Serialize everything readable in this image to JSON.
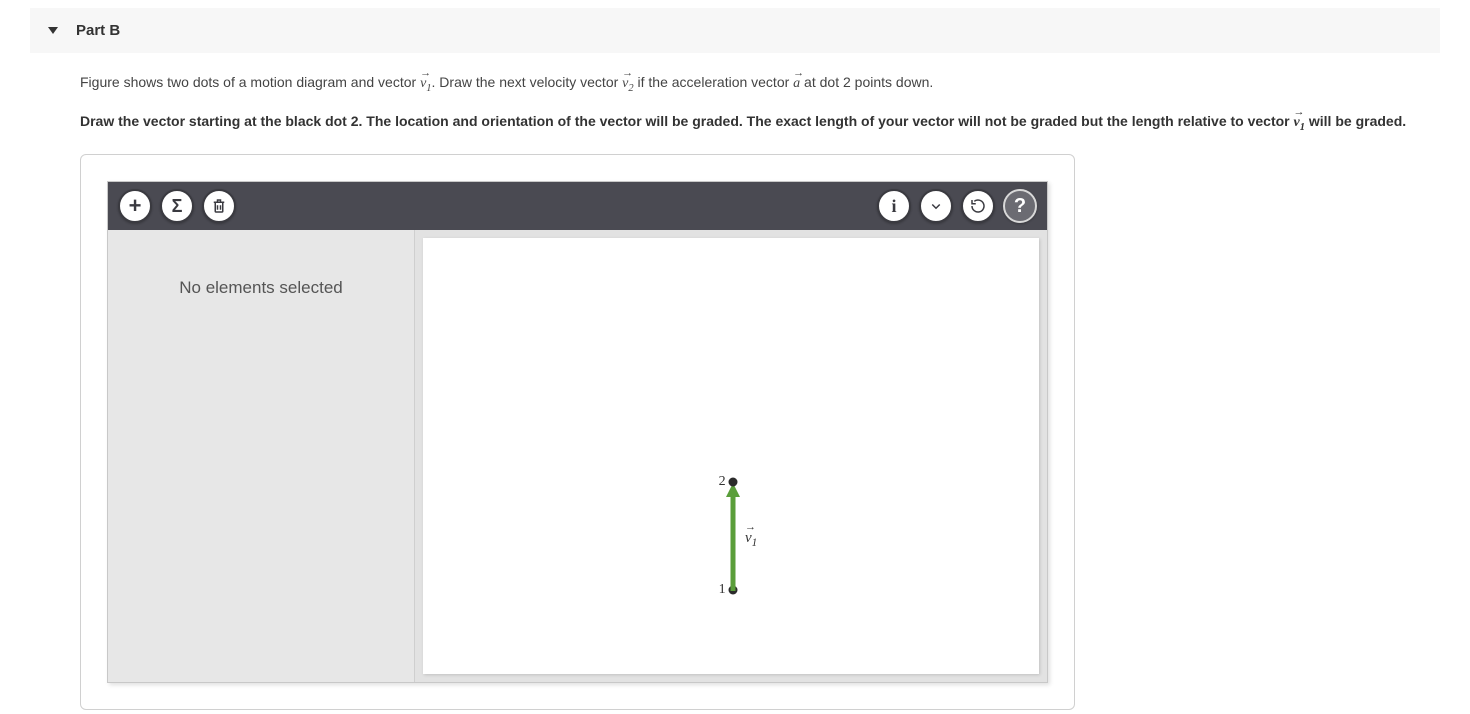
{
  "header": {
    "part_label": "Part B"
  },
  "question": {
    "line1_a": "Figure shows two dots of a motion diagram and vector ",
    "v1": "v",
    "v1_sub": "1",
    "line1_b": ". Draw the next velocity vector ",
    "v2": "v",
    "v2_sub": "2",
    "line1_c": " if the acceleration vector ",
    "avec": "a",
    "line1_d": " at dot 2 points down.",
    "bold_a": "Draw the vector starting at the black dot 2. The location and orientation of the vector will be graded. The exact length of your vector will not be graded but the length relative to vector ",
    "bold_v1": "v",
    "bold_v1_sub": "1",
    "bold_b": " will be graded."
  },
  "widget": {
    "side_panel_msg": "No elements selected",
    "toolbar": {
      "add": "+",
      "sum": "Σ",
      "info": "i",
      "help": "?"
    },
    "diagram": {
      "dot1_label": "1",
      "dot2_label": "2",
      "v1_label": "v",
      "v1_sub": "1"
    }
  }
}
